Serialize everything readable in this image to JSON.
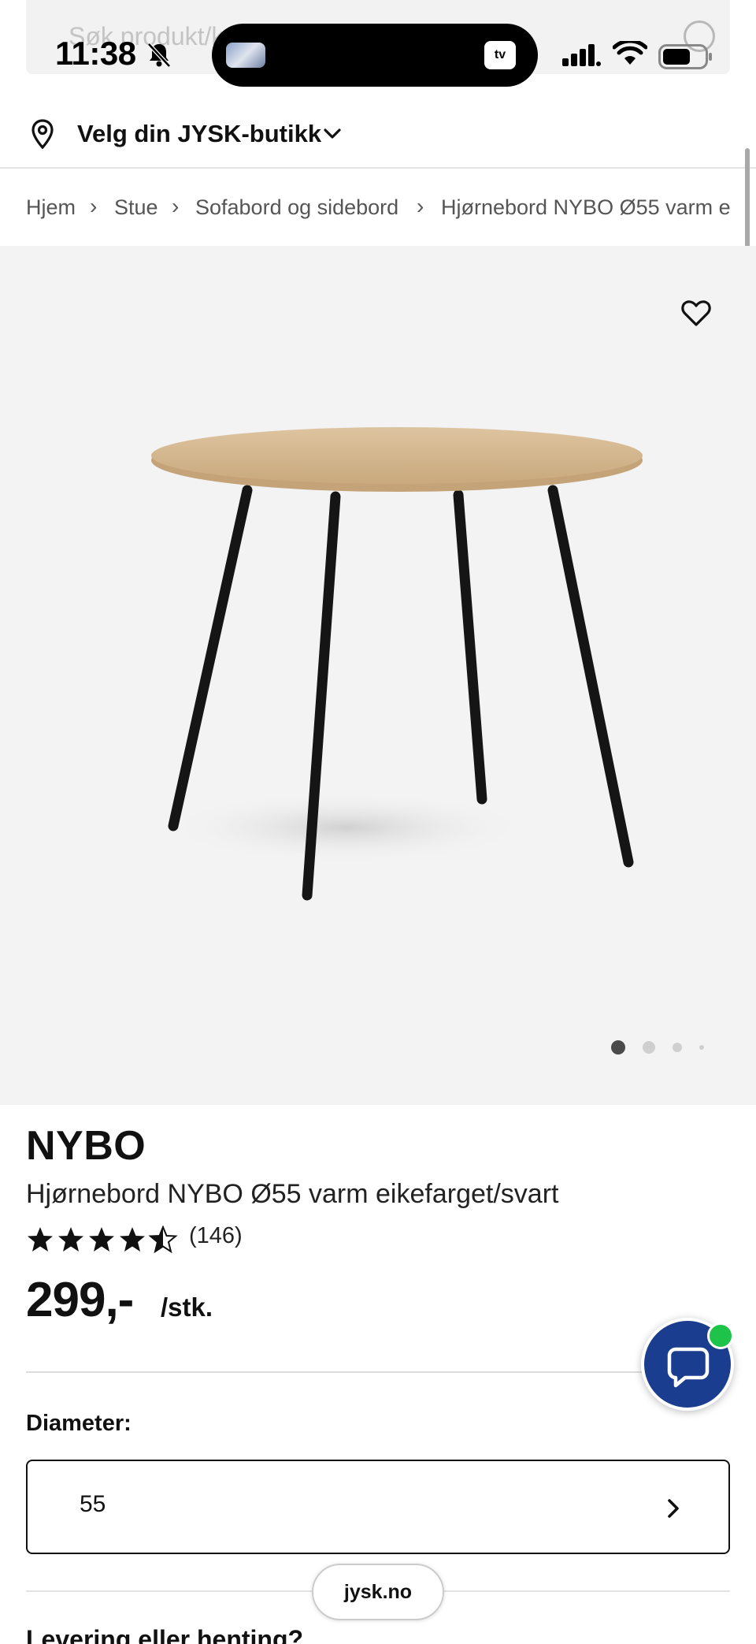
{
  "search": {
    "placeholder": "Søk produkt/kat"
  },
  "status_bar": {
    "time": "11:38",
    "tv_badge": "tv"
  },
  "store": {
    "label": "Velg din JYSK-butikk"
  },
  "breadcrumb": {
    "items": [
      "Hjem",
      "Stue",
      "Sofabord og sidebord",
      "Hjørnebord NYBO Ø55 varm e"
    ],
    "separator": "›"
  },
  "gallery": {
    "image_count": 4,
    "active_index": 0
  },
  "product": {
    "brand": "NYBO",
    "name": "Hjørnebord NYBO Ø55 varm eikefarget/svart",
    "rating": 4.5,
    "rating_max": 5,
    "review_count": "(146)",
    "price": "299,-",
    "price_unit": "/stk."
  },
  "option": {
    "label": "Diameter:",
    "value": "55"
  },
  "browser": {
    "url": "jysk.no"
  },
  "delivery": {
    "heading": "Levering eller henting?"
  },
  "colors": {
    "chat_button": "#1a3d8f",
    "chat_online": "#1ec44a",
    "gallery_bg": "#f3f3f3"
  }
}
